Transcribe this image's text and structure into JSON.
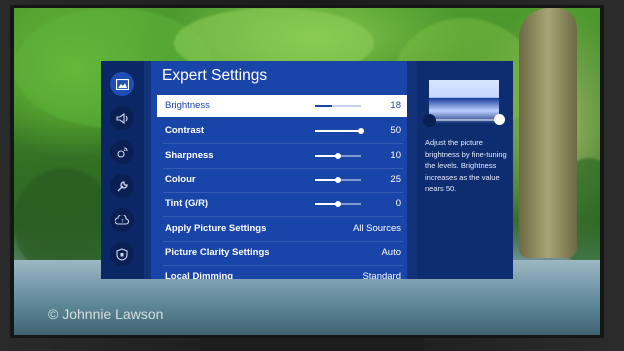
{
  "watermark": "© Johnnie Lawson",
  "menu": {
    "title": "Expert Settings",
    "sidebar_icons": [
      "picture-icon",
      "sound-icon",
      "broadcast-icon",
      "tools-icon",
      "cloud-support-icon",
      "shield-icon"
    ],
    "items": [
      {
        "label": "Brightness",
        "value": "18",
        "level": 0.36
      },
      {
        "label": "Contrast",
        "value": "50",
        "level": 1.0
      },
      {
        "label": "Sharpness",
        "value": "10",
        "level": 0.5
      },
      {
        "label": "Colour",
        "value": "25",
        "level": 0.5
      },
      {
        "label": "Tint (G/R)",
        "value": "0",
        "level": 0.5
      },
      {
        "label": "Apply Picture Settings",
        "value": "All Sources"
      },
      {
        "label": "Picture Clarity Settings",
        "value": "Auto"
      },
      {
        "label": "Local Dimming",
        "value": "Standard"
      }
    ]
  },
  "help": {
    "description": "Adjust the picture brightness by fine-tuning the levels. Brightness increases as the value nears 50."
  },
  "colors": {
    "accent": "#1a45a8",
    "selected_bg": "#ffffff"
  }
}
